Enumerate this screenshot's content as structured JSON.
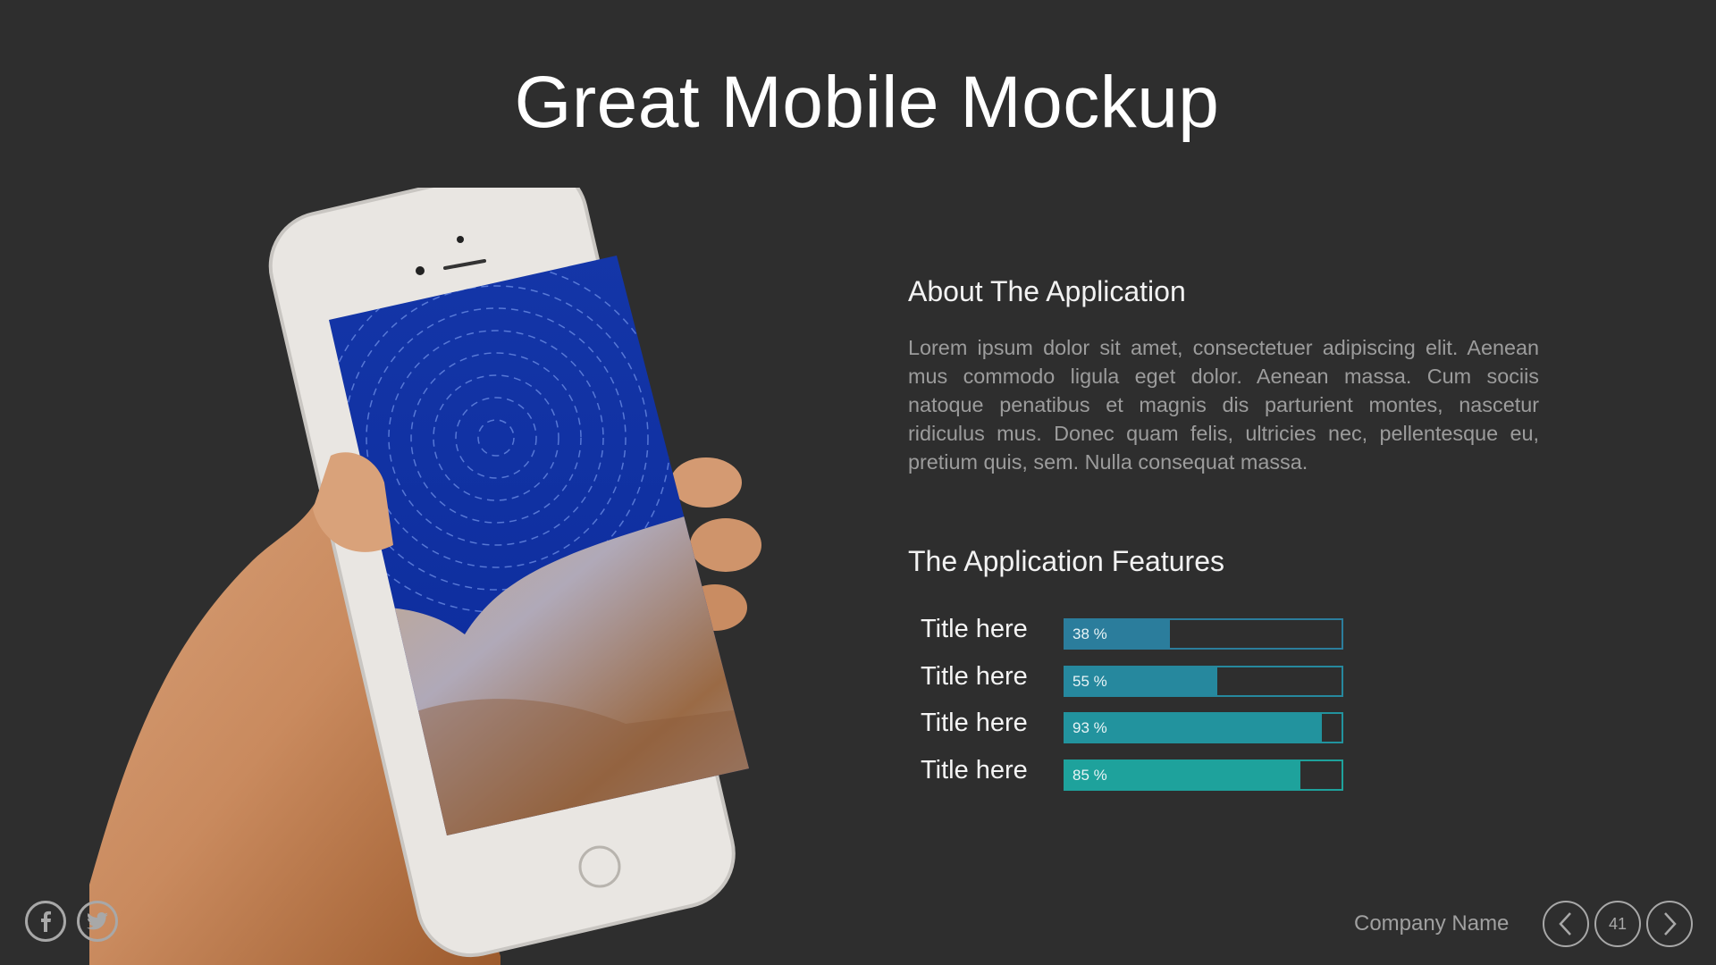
{
  "slide": {
    "title": "Great Mobile Mockup",
    "hero_image": "hand-holding-phone-with-star-trails-wallpaper"
  },
  "about": {
    "heading": "About The Application",
    "body": "Lorem ipsum dolor sit amet, consectetuer adipiscing elit. Aenean mus commodo ligula eget dolor. Aenean massa. Cum sociis natoque penatibus et magnis dis parturient montes, nascetur ridiculus mus. Donec quam felis, ultricies nec, pellentesque eu, pretium quis, sem. Nulla consequat massa."
  },
  "features": {
    "heading": "The Application Features",
    "items": [
      {
        "label": "Title here",
        "value": 38,
        "value_text": "38 %",
        "color": "#2b7d9c"
      },
      {
        "label": "Title here",
        "value": 55,
        "value_text": "55 %",
        "color": "#26889e"
      },
      {
        "label": "Title here",
        "value": 93,
        "value_text": "93 %",
        "color": "#22939e"
      },
      {
        "label": "Title here",
        "value": 85,
        "value_text": "85 %",
        "color": "#1ea29c"
      }
    ]
  },
  "footer": {
    "social": [
      {
        "icon": "facebook-icon",
        "glyph": "f"
      },
      {
        "icon": "twitter-icon",
        "glyph": "t"
      }
    ],
    "company": "Company Name",
    "page_number": "41",
    "prev_icon": "chevron-left-icon",
    "next_icon": "chevron-right-icon"
  }
}
